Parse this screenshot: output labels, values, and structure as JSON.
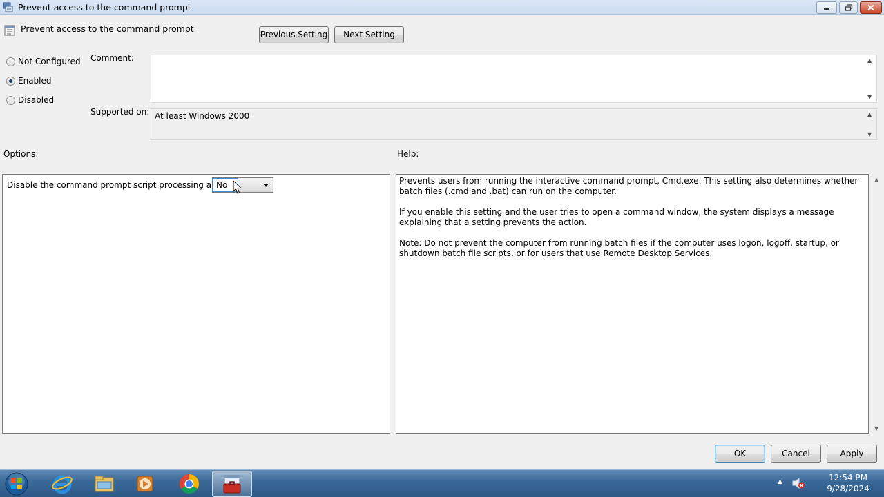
{
  "window": {
    "title": "Prevent access to the command prompt",
    "setting_name": "Prevent access to the command prompt"
  },
  "nav": {
    "previous_label": "Previous Setting",
    "next_label": "Next Setting"
  },
  "state": {
    "options": [
      {
        "label": "Not Configured",
        "selected": false
      },
      {
        "label": "Enabled",
        "selected": true
      },
      {
        "label": "Disabled",
        "selected": false
      }
    ]
  },
  "comment": {
    "label": "Comment:",
    "value": ""
  },
  "supported": {
    "label": "Supported on:",
    "value": "At least Windows 2000"
  },
  "options_panel": {
    "heading": "Options:",
    "option_label": "Disable the command prompt script processing also?",
    "option_value": "No"
  },
  "help_panel": {
    "heading": "Help:",
    "paragraphs": [
      "Prevents users from running the interactive command prompt, Cmd.exe. This setting also determines whether batch files (.cmd and .bat) can run on the computer.",
      "If you enable this setting and the user tries to open a command window, the system displays a message explaining that a setting prevents the action.",
      "Note: Do not prevent the computer from running batch files if the computer uses logon, logoff, startup, or shutdown batch file scripts, or for users that use Remote Desktop Services."
    ]
  },
  "dialog_buttons": {
    "ok": "OK",
    "cancel": "Cancel",
    "apply": "Apply"
  },
  "taskbar": {
    "items": [
      "internet-explorer-icon",
      "windows-explorer-icon",
      "media-player-icon",
      "chrome-icon",
      "group-policy-editor-icon"
    ],
    "active_item": "group-policy-editor-icon",
    "time": "12:54 PM",
    "date": "9/28/2024"
  },
  "colors": {
    "taskbar": "#3c6a98",
    "titlebar": "#c9dbef",
    "close_button": "#c7462c"
  }
}
